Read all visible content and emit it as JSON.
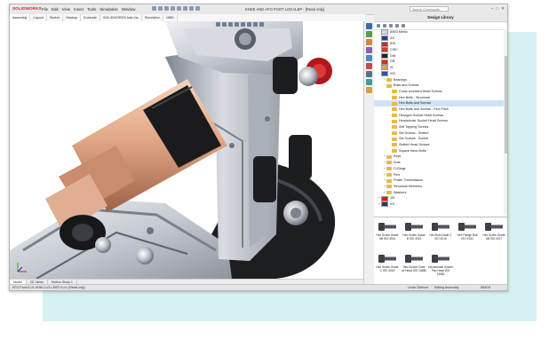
{
  "app": {
    "brand": "SOLIDWORKS",
    "menu": [
      "File",
      "Edit",
      "View",
      "Insert",
      "Tools",
      "Simulation",
      "Window"
    ],
    "document_title": "KNEE AND AFO FOOT LOGALEP - [Read only]",
    "search_placeholder": "Search Commands",
    "window_controls": [
      "–",
      "□",
      "✕"
    ]
  },
  "command_tabs": [
    "Assembly",
    "Layout",
    "Sketch",
    "Markup",
    "Evaluate",
    "SOLIDWORKS Add-Ins",
    "Simulation",
    "MBD"
  ],
  "model_tabs": [
    "Model",
    "3D Views",
    "Motion Study 1"
  ],
  "status_bar": {
    "left": "VFO Foot<1>/1-KHB<1>/1>-KBT<1>/1 (Read only)",
    "under_defined": "Under Defined",
    "editing": "Editing Assembly",
    "units": "MMGS"
  },
  "design_library": {
    "title": "Design Library",
    "tree": [
      {
        "label": "ANSI Metric",
        "level": 1,
        "kind": "flag",
        "toggle": "",
        "color": "#d0d8e8"
      },
      {
        "label": "AS",
        "level": 1,
        "kind": "flag",
        "toggle": "",
        "color": "#1f3f99"
      },
      {
        "label": "BSI",
        "level": 1,
        "kind": "flag",
        "toggle": "",
        "color": "#c62a2a"
      },
      {
        "label": "CISC",
        "level": 1,
        "kind": "flag",
        "toggle": "",
        "color": "#d33"
      },
      {
        "label": "DIN",
        "level": 1,
        "kind": "flag",
        "toggle": "",
        "color": "#222"
      },
      {
        "label": "GB",
        "level": 1,
        "kind": "flag",
        "toggle": "",
        "color": "#de2910"
      },
      {
        "label": "IS",
        "level": 1,
        "kind": "flag",
        "toggle": "",
        "color": "#f29b38"
      },
      {
        "label": "ISO",
        "level": 1,
        "kind": "flag",
        "toggle": "−",
        "color": "#2f4fa3"
      },
      {
        "label": "Bearings",
        "level": 2,
        "kind": "folder",
        "toggle": "+"
      },
      {
        "label": "Bolts and Screws",
        "level": 2,
        "kind": "folder",
        "toggle": "−"
      },
      {
        "label": "Cross recessed Head Screws",
        "level": 3,
        "kind": "folder",
        "toggle": ""
      },
      {
        "label": "Hex Bolts - Structural",
        "level": 3,
        "kind": "folder",
        "toggle": ""
      },
      {
        "label": "Hex Bolts and Screws",
        "level": 3,
        "kind": "folder",
        "toggle": "",
        "selected": true
      },
      {
        "label": "Hex Bolts and Screws - Fine Pitch",
        "level": 3,
        "kind": "folder",
        "toggle": ""
      },
      {
        "label": "Hexagon Socket Head Screws",
        "level": 3,
        "kind": "folder",
        "toggle": ""
      },
      {
        "label": "Hexalobular Socket Head Screws",
        "level": 3,
        "kind": "folder",
        "toggle": ""
      },
      {
        "label": "Self Tapping Screws",
        "level": 3,
        "kind": "folder",
        "toggle": ""
      },
      {
        "label": "Set Screws - Slotted",
        "level": 3,
        "kind": "folder",
        "toggle": ""
      },
      {
        "label": "Set Screws - Socket",
        "level": 3,
        "kind": "folder",
        "toggle": ""
      },
      {
        "label": "Slotted Head Screws",
        "level": 3,
        "kind": "folder",
        "toggle": ""
      },
      {
        "label": "Square Neck Bolts",
        "level": 3,
        "kind": "folder",
        "toggle": ""
      },
      {
        "label": "Keys",
        "level": 2,
        "kind": "folder",
        "toggle": "+"
      },
      {
        "label": "Nuts",
        "level": 2,
        "kind": "folder",
        "toggle": "+"
      },
      {
        "label": "O-Rings",
        "level": 2,
        "kind": "folder",
        "toggle": "+"
      },
      {
        "label": "Pins",
        "level": 2,
        "kind": "folder",
        "toggle": "+"
      },
      {
        "label": "Power Transmission",
        "level": 2,
        "kind": "folder",
        "toggle": "+"
      },
      {
        "label": "Structural Members",
        "level": 2,
        "kind": "folder",
        "toggle": "+"
      },
      {
        "label": "Washers",
        "level": 2,
        "kind": "folder",
        "toggle": "+"
      },
      {
        "label": "JIS",
        "level": 1,
        "kind": "flag",
        "toggle": "+",
        "color": "#e11"
      },
      {
        "label": "KS",
        "level": 1,
        "kind": "flag",
        "toggle": "+",
        "color": "#335"
      }
    ],
    "parts": [
      "Hex Screw Grade AB ISO 4014",
      "Hex Screw Grade B ISO 4015",
      "Hex Bolt Grade C ISO 4016",
      "Hex Flange Bolt ISO 4162",
      "Hex Screw Grade AB ISO 4017",
      "Hex Screw Grade C ISO 4018",
      "Hex Socket Chee se Head ISO 14580",
      "Hexalobular Socket Pan Head ISO 14583"
    ]
  },
  "task_pane_colors": [
    "#3c6bb5",
    "#5c9b4a",
    "#d6863a",
    "#8c5fb3",
    "#4a8bc0",
    "#c54a4a",
    "#5b6f8c",
    "#3a9f9a",
    "#d0a23a"
  ]
}
